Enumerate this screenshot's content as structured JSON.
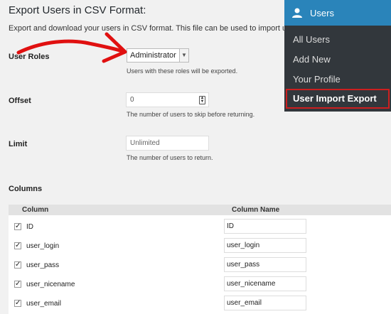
{
  "page": {
    "title": "Export Users in CSV Format:",
    "intro": "Export and download your users in CSV format. This file can be used to import users bac"
  },
  "form": {
    "roles": {
      "label": "User Roles",
      "selected": "Administrator",
      "description": "Users with these roles will be exported."
    },
    "offset": {
      "label": "Offset",
      "value": "0",
      "description": "The number of users to skip before returning."
    },
    "limit": {
      "label": "Limit",
      "placeholder": "Unlimited",
      "description": "The number of users to return."
    },
    "columns_label": "Columns"
  },
  "table": {
    "headers": [
      "Column",
      "Column Name"
    ],
    "rows": [
      {
        "column": "ID",
        "name": "ID",
        "checked": true
      },
      {
        "column": "user_login",
        "name": "user_login",
        "checked": true
      },
      {
        "column": "user_pass",
        "name": "user_pass",
        "checked": true
      },
      {
        "column": "user_nicename",
        "name": "user_nicename",
        "checked": true
      },
      {
        "column": "user_email",
        "name": "user_email",
        "checked": true
      }
    ]
  },
  "menu": {
    "header": "Users",
    "header_icon": "user-icon",
    "items": [
      "All Users",
      "Add New",
      "Your Profile",
      "User Import Export"
    ],
    "selected_index": 3
  },
  "colors": {
    "menu_bg": "#32373c",
    "menu_header": "#2a84ba",
    "highlight_border": "#cc1f1f",
    "annotation_arrow": "#e01010"
  }
}
